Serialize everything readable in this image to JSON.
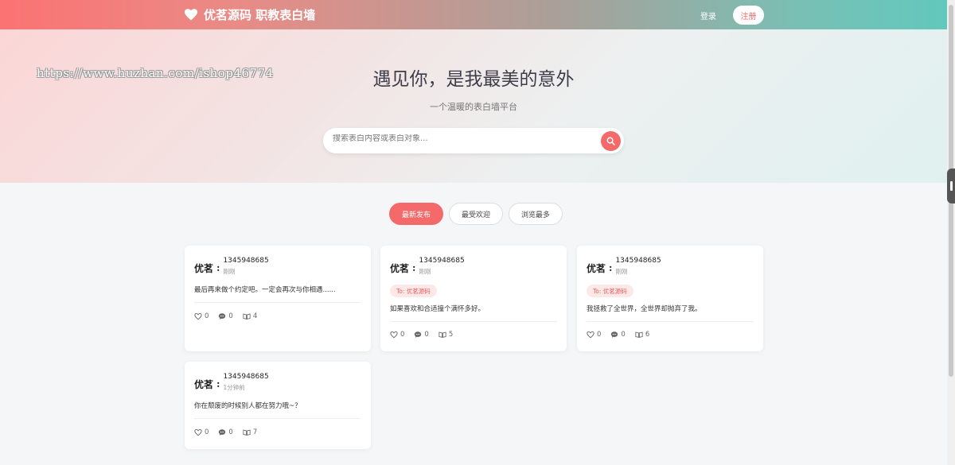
{
  "nav": {
    "brand": "优茗源码 职教表白墙",
    "login": "登录",
    "register": "注册"
  },
  "hero": {
    "watermark": "https://www.huzhan.com/ishop46774",
    "title": "遇见你，是我最美的意外",
    "subtitle": "一个温暖的表白墙平台",
    "search_placeholder": "搜索表白内容或表白对象..."
  },
  "tabs": [
    {
      "label": "最新发布"
    },
    {
      "label": "最受欢迎"
    },
    {
      "label": "浏览最多"
    }
  ],
  "colors": {
    "accent": "#f46a6a",
    "nav_left": "#fb7373",
    "nav_right": "#62c8bd"
  },
  "cards": [
    {
      "logo": "优茗",
      "author": "1345948685",
      "time": "刚刚",
      "to": "",
      "content": "最后再来做个约定吧。一定会再次与你相遇......",
      "likes": "0",
      "comments": "0",
      "views": "4"
    },
    {
      "logo": "优茗",
      "author": "1345948685",
      "time": "刚刚",
      "to": "To: 优茗源码",
      "content": "如果喜欢和合适撞个满怀多好。",
      "likes": "0",
      "comments": "0",
      "views": "5"
    },
    {
      "logo": "优茗",
      "author": "1345948685",
      "time": "刚刚",
      "to": "To: 优茗源码",
      "content": "我拯救了全世界，全世界却抛弃了我。",
      "likes": "0",
      "comments": "0",
      "views": "6"
    },
    {
      "logo": "优茗",
      "author": "1345948685",
      "time": "1分钟前",
      "to": "",
      "content": "你在颓废的时候别人都在努力哦~？",
      "likes": "0",
      "comments": "0",
      "views": "7"
    }
  ]
}
